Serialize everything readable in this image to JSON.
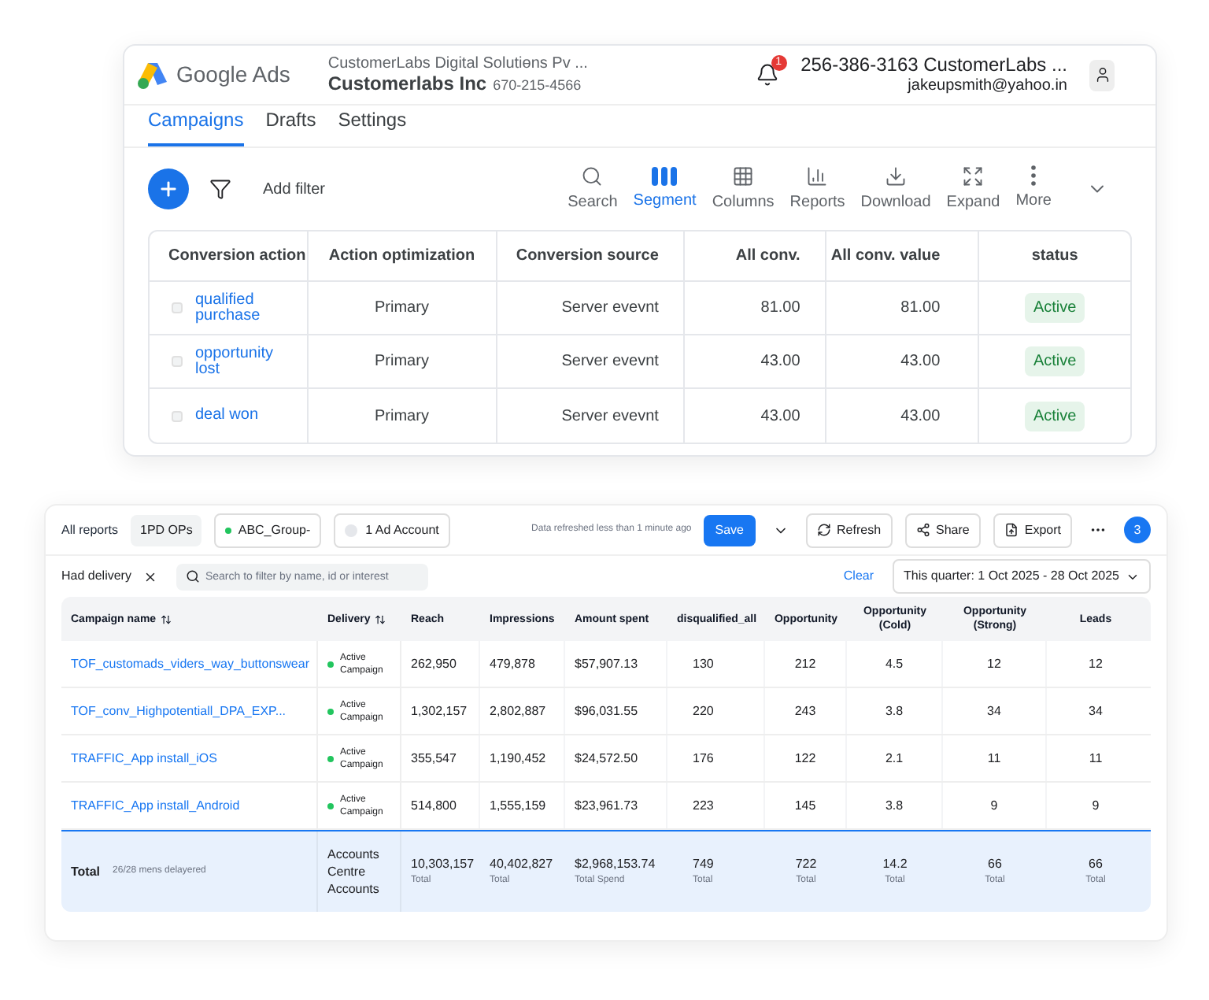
{
  "header": {
    "logo_text": "Google Ads",
    "account_line": "CustomerLabs Digital Solutiөns Pv ...",
    "account_name": "Customerlabs Inc",
    "account_phone": "670-215-4566",
    "notification_count": "1",
    "contact_line": "256-386-3163 CustomerLabs ...",
    "email": "jakeupsmith@yahoo.in"
  },
  "tabs": [
    {
      "label": "Campaigns",
      "selected": true
    },
    {
      "label": "Drafts",
      "selected": false
    },
    {
      "label": "Settings",
      "selected": false
    }
  ],
  "toolbar": {
    "add_filter": "Add filter",
    "tools": [
      {
        "kind": "search",
        "label": "Search",
        "selected": false
      },
      {
        "kind": "segment",
        "label": "Segment",
        "selected": true
      },
      {
        "kind": "columns",
        "label": "Columns",
        "selected": false
      },
      {
        "kind": "reports",
        "label": "Reports",
        "selected": false
      },
      {
        "kind": "download",
        "label": "Download",
        "selected": false
      },
      {
        "kind": "expand",
        "label": "Expand",
        "selected": false
      },
      {
        "kind": "more",
        "label": "More",
        "selected": false
      }
    ]
  },
  "conversion_table": {
    "columns": [
      "Conversion action",
      "Action optimization",
      "Conversion source",
      "All conv.",
      "All conv. value",
      "status"
    ],
    "rows": [
      {
        "checked": false,
        "action": "qualified purchase",
        "optimization": "Primary",
        "source": "Server evevnt",
        "all_conv": "81.00",
        "all_conv_value": "81.00",
        "status": "Active"
      },
      {
        "checked": false,
        "action": "opportunity lost",
        "optimization": "Primary",
        "source": "Server evevnt",
        "all_conv": "43.00",
        "all_conv_value": "43.00",
        "status": "Active"
      },
      {
        "checked": false,
        "action": "deal won",
        "optimization": "Primary",
        "source": "Server evevnt",
        "all_conv": "43.00",
        "all_conv_value": "43.00",
        "status": "Active"
      }
    ]
  },
  "report": {
    "top_bar": {
      "all_reports": "All reports",
      "tag": "1PD OPs",
      "group": "ABC_Group-",
      "account": "1 Ad Account",
      "refreshed": "Data refreshed less than 1 minute ago",
      "save": "Save",
      "refresh": "Refresh",
      "share": "Share",
      "export": "Export",
      "count": "3"
    },
    "filter_bar": {
      "filter": "Had delivery",
      "search_placeholder": "Search to filter by name, id or interest",
      "clear": "Clear",
      "date_range": "This quarter: 1 Oct 2025 - 28 Oct 2025"
    },
    "columns": [
      {
        "label": "Campaign name",
        "sortable": true
      },
      {
        "label": "Delivery",
        "sortable": true
      },
      {
        "label": "Reach",
        "sortable": false
      },
      {
        "label": "Impressions",
        "sortable": false
      },
      {
        "label": "Amount spent",
        "sortable": false
      },
      {
        "label": "disqualified_all",
        "sortable": false
      },
      {
        "label": "Opportunity",
        "sortable": false
      },
      {
        "label": "Opportunity (Cold)",
        "sortable": false
      },
      {
        "label": "Opportunity (Strong)",
        "sortable": false
      },
      {
        "label": "Leads",
        "sortable": false
      }
    ],
    "rows": [
      {
        "campaign": "TOF_customads_viders_way_buttonswear",
        "delivery": "Active Campaign",
        "values": [
          "262,950",
          "479,878",
          "$57,907.13",
          "130",
          "212",
          "4.5",
          "12",
          "12"
        ]
      },
      {
        "campaign": "TOF_conv_Highpotentiall_DPA_EXP...",
        "delivery": "Active Campaign",
        "values": [
          "1,302,157",
          "2,802,887",
          "$96,031.55",
          "220",
          "243",
          "3.8",
          "34",
          "34"
        ]
      },
      {
        "campaign": "TRAFFIC_App install_iOS",
        "delivery": "Active Campaign",
        "values": [
          "355,547",
          "1,190,452",
          "$24,572.50",
          "176",
          "122",
          "2.1",
          "11",
          "11"
        ]
      },
      {
        "campaign": "TRAFFIC_App install_Android",
        "delivery": "Active Campaign",
        "values": [
          "514,800",
          "1,555,159",
          "$23,961.73",
          "223",
          "145",
          "3.8",
          "9",
          "9"
        ]
      }
    ],
    "total": {
      "label": "Total",
      "note": "26/28 mens delayered",
      "delivery_lines": [
        "Accounts",
        "Centre",
        "Accounts"
      ],
      "cells": [
        {
          "value": "10,303,157",
          "sub": "Total"
        },
        {
          "value": "40,402,827",
          "sub": "Total"
        },
        {
          "value": "$2,968,153.74",
          "sub": "Total Spend"
        },
        {
          "value": "749",
          "sub": "Total"
        },
        {
          "value": "722",
          "sub": "Total"
        },
        {
          "value": "14.2",
          "sub": "Total"
        },
        {
          "value": "66",
          "sub": "Total"
        },
        {
          "value": "66",
          "sub": "Total"
        }
      ]
    }
  }
}
